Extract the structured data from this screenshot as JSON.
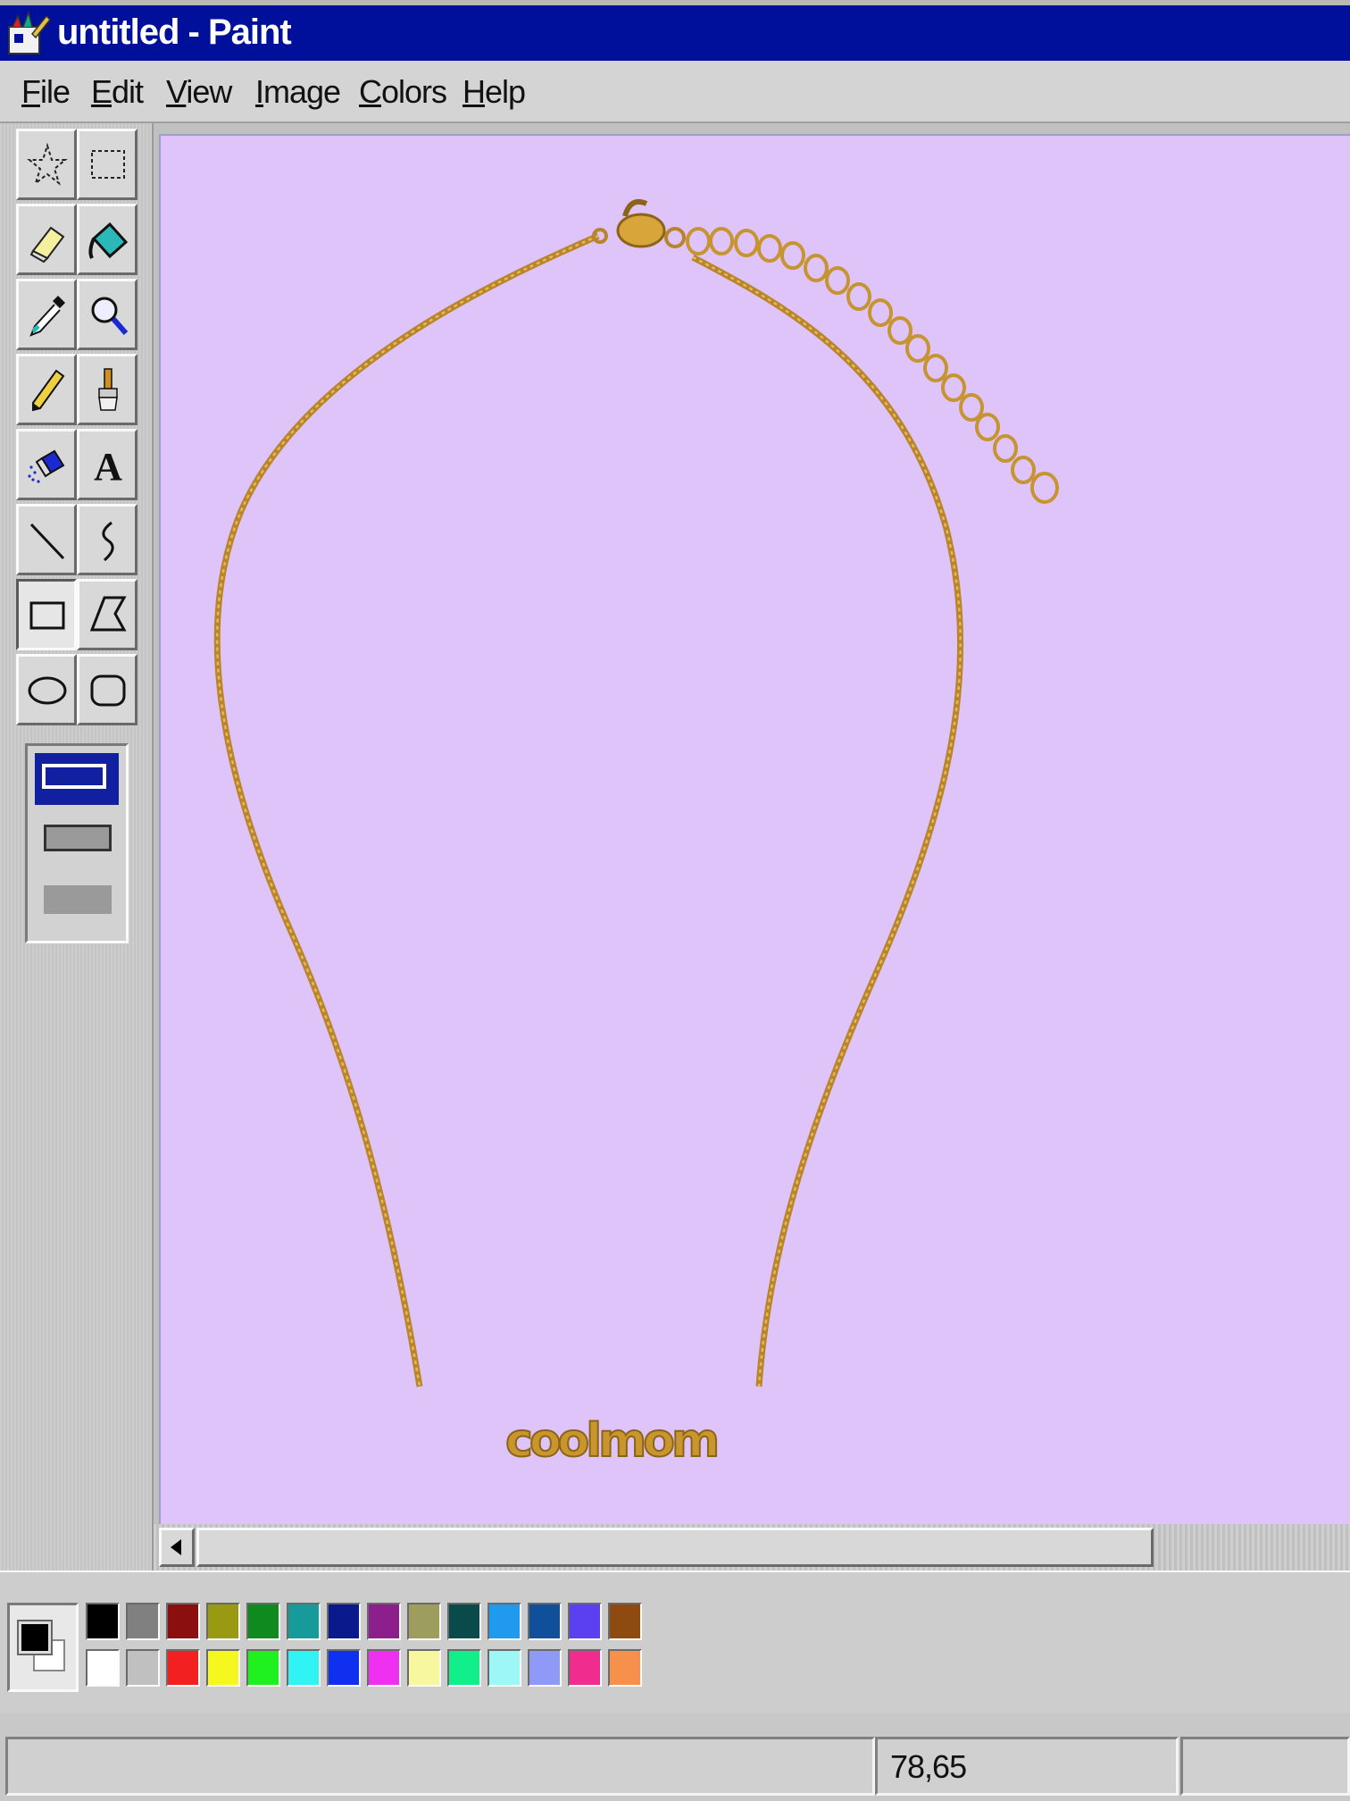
{
  "window": {
    "title": "untitled - Paint",
    "title_bar_color": "#00109a"
  },
  "menu": {
    "items": [
      {
        "accel": "F",
        "rest": "ile"
      },
      {
        "accel": "E",
        "rest": "dit"
      },
      {
        "accel": "V",
        "rest": "iew"
      },
      {
        "accel": "I",
        "rest": "mage"
      },
      {
        "accel": "C",
        "rest": "olors"
      },
      {
        "accel": "H",
        "rest": "elp"
      }
    ]
  },
  "toolbox": {
    "tools": [
      {
        "name": "free-form-select",
        "icon": "star-select-icon"
      },
      {
        "name": "rect-select",
        "icon": "dotted-rect-icon"
      },
      {
        "name": "eraser",
        "icon": "eraser-icon"
      },
      {
        "name": "fill",
        "icon": "paint-bucket-icon"
      },
      {
        "name": "pick-color",
        "icon": "eyedropper-icon"
      },
      {
        "name": "magnifier",
        "icon": "magnifier-icon"
      },
      {
        "name": "pencil",
        "icon": "pencil-icon"
      },
      {
        "name": "brush",
        "icon": "brush-icon"
      },
      {
        "name": "airbrush",
        "icon": "airbrush-icon"
      },
      {
        "name": "text",
        "icon": "text-icon"
      },
      {
        "name": "line",
        "icon": "line-icon"
      },
      {
        "name": "curve",
        "icon": "curve-icon"
      },
      {
        "name": "rectangle",
        "icon": "rectangle-icon"
      },
      {
        "name": "polygon",
        "icon": "polygon-icon"
      },
      {
        "name": "ellipse",
        "icon": "ellipse-icon"
      },
      {
        "name": "rounded-rectangle",
        "icon": "rounded-rect-icon"
      }
    ],
    "selected_tool": "rectangle",
    "text_glyph": "A",
    "fill_style_selected": "outline"
  },
  "canvas": {
    "background": "#dfc4fa",
    "pendant_text": "coolmom",
    "chain_color": "#c9962e"
  },
  "palette": {
    "foreground": "#000000",
    "background": "#ffffff",
    "top_row": [
      "#000000",
      "#808080",
      "#8b0f0f",
      "#9a9a12",
      "#0f8a1e",
      "#179a9a",
      "#0a1a8c",
      "#8c1f8c",
      "#9d9d5e",
      "#0b4a4a",
      "#1f9aef",
      "#10509a",
      "#5a40f0",
      "#8f4a10"
    ],
    "bottom_row": [
      "#ffffff",
      "#c0c0c0",
      "#f22020",
      "#f7f720",
      "#20f020",
      "#30f4f4",
      "#1030f0",
      "#f030f0",
      "#f7f7a0",
      "#10ef8a",
      "#9ef7f7",
      "#8f9af7",
      "#f02c8f",
      "#f7904a"
    ]
  },
  "status": {
    "coordinates": "78,65"
  }
}
